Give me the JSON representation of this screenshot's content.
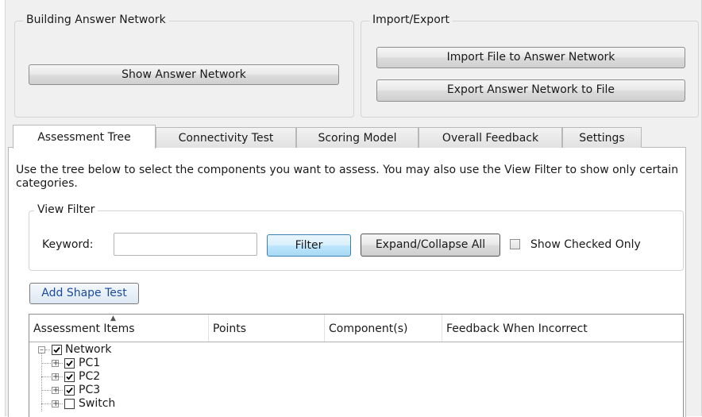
{
  "building": {
    "title": "Building Answer Network",
    "show_btn": "Show Answer Network"
  },
  "import_export": {
    "title": "Import/Export",
    "import_btn": "Import File to Answer Network",
    "export_btn": "Export Answer Network to File"
  },
  "tabs": [
    {
      "label": "Assessment Tree",
      "active": true
    },
    {
      "label": "Connectivity Test",
      "active": false
    },
    {
      "label": "Scoring Model",
      "active": false
    },
    {
      "label": "Overall Feedback",
      "active": false
    },
    {
      "label": "Settings",
      "active": false
    }
  ],
  "description": "Use the tree below to select the components you want to assess. You may also use the View Filter to show only certain categories.",
  "view_filter": {
    "title": "View Filter",
    "keyword_label": "Keyword:",
    "keyword_value": "",
    "filter_btn": "Filter",
    "expand_btn": "Expand/Collapse All",
    "show_checked_label": "Show Checked Only",
    "show_checked": false
  },
  "add_shape_btn": "Add Shape Test",
  "grid": {
    "columns": [
      "Assessment Items",
      "Points",
      "Component(s)",
      "Feedback When Incorrect"
    ],
    "sort_column": "Assessment Items",
    "rows": [
      {
        "label": "Network",
        "checked": true,
        "expander": "minus",
        "level": 0
      },
      {
        "label": "PC1",
        "checked": true,
        "expander": "plus",
        "level": 1
      },
      {
        "label": "PC2",
        "checked": true,
        "expander": "plus",
        "level": 1
      },
      {
        "label": "PC3",
        "checked": true,
        "expander": "plus",
        "level": 1
      },
      {
        "label": "Switch",
        "checked": false,
        "expander": "plus",
        "level": 1
      }
    ]
  }
}
